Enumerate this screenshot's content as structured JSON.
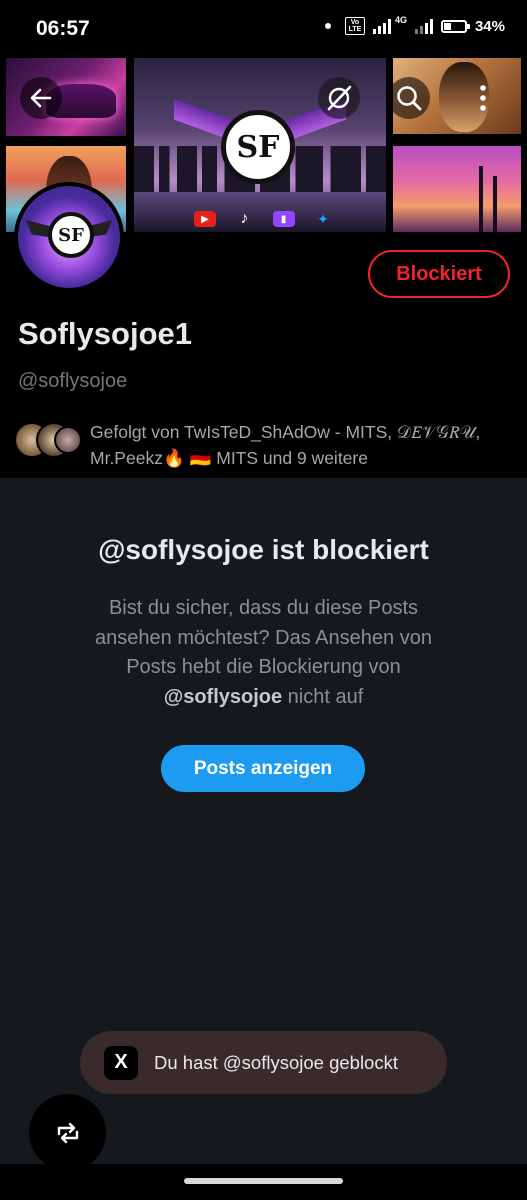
{
  "status_bar": {
    "time": "06:57",
    "volte": "Vo LTE",
    "network": "4G",
    "battery": "34%"
  },
  "banner": {
    "logo_text": "SF",
    "icons": [
      "back-arrow-icon",
      "grok-icon",
      "search-icon",
      "more-vertical-icon"
    ]
  },
  "profile": {
    "display_name": "Soflysojoe1",
    "handle": "@soflysojoe",
    "blocked_button": "Blockiert",
    "avatar_logo": "SF",
    "followed_by": "Gefolgt von TwIsTeD_ShAdOw - MITS, 𝒟𝐸𝒱𝒢𝑅𝒰, Mr.Peekz🔥 🇩🇪 MITS und 9 weitere"
  },
  "blocked_notice": {
    "title": "@soflysojoe ist blockiert",
    "desc_part1": "Bist du sicher, dass du diese Posts ansehen möchtest? Das Ansehen von Posts hebt die Blockierung von ",
    "desc_handle": "@soflysojoe",
    "desc_part2": " nicht auf",
    "show_posts_button": "Posts anzeigen"
  },
  "toast": {
    "text": "Du hast @soflysojoe geblockt",
    "logo": "X"
  },
  "colors": {
    "accent_blue": "#1d9bf0",
    "blocked_red": "#f4212e",
    "background": "#15181c",
    "toast_bg": "#3b2a2c"
  }
}
